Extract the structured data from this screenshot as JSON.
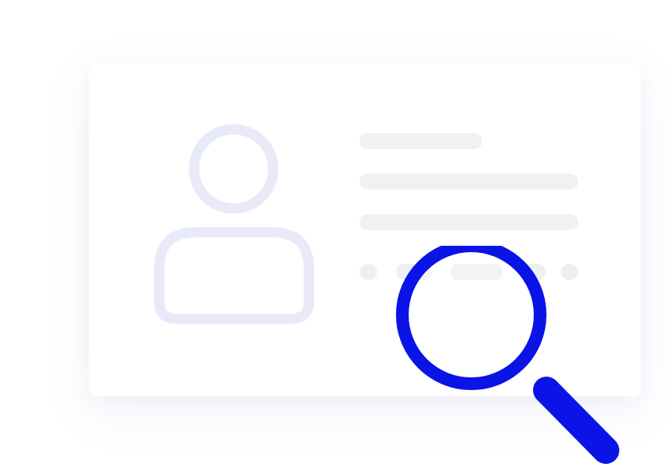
{
  "colors": {
    "accent": "#0a14e6",
    "avatar": "#e8eaf8",
    "placeholder_line": "#f1f1f3",
    "card_background": "#ffffff",
    "page_background": "#ffffff"
  },
  "icons": {
    "avatar": "user-avatar-icon",
    "magnifier": "magnifying-glass-icon"
  }
}
